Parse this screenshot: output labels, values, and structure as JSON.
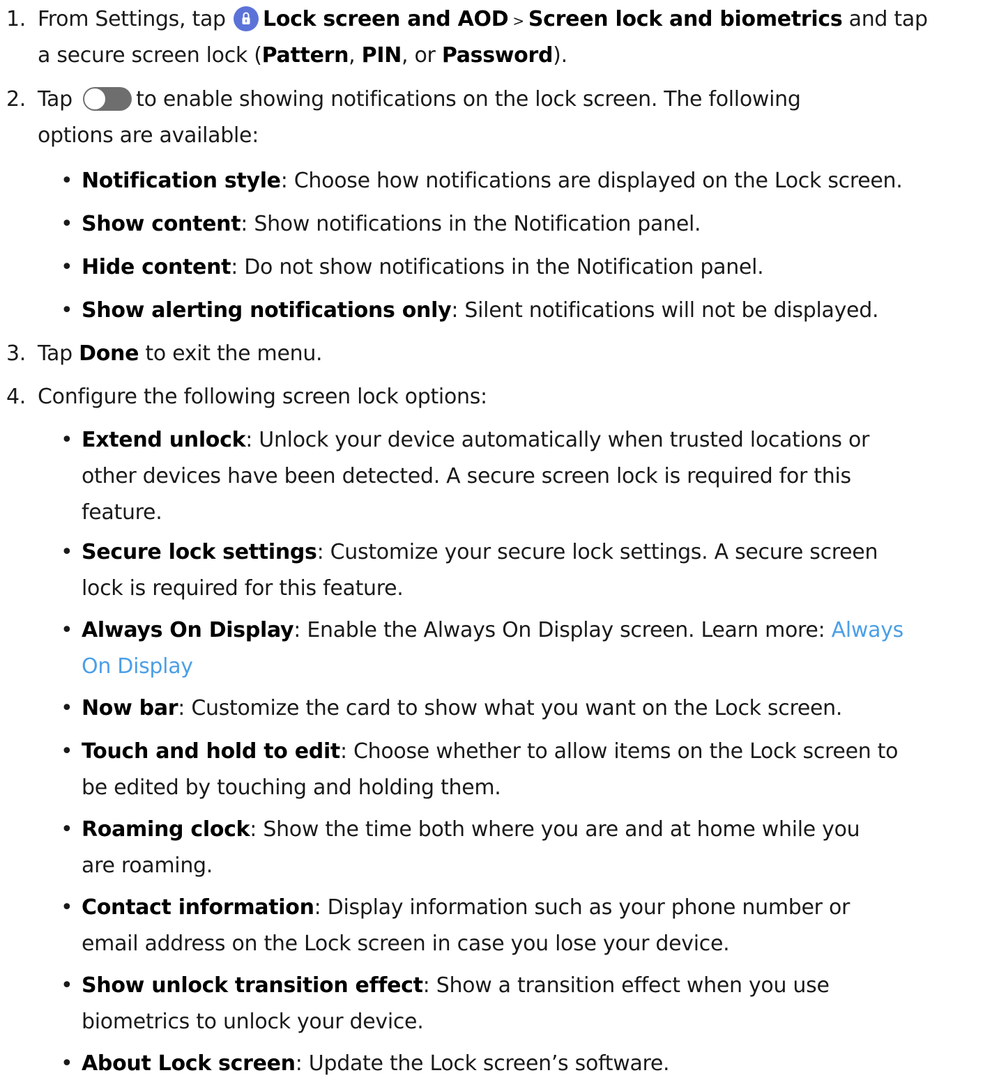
{
  "steps": [
    {
      "number": "1.",
      "lines": [
        {
          "pre": "From Settings, tap",
          "icon": "lock-icon",
          "b1": "Lock screen and AOD",
          "sep": " > ",
          "b2": "Screen lock and biometrics",
          "post": " and tap"
        },
        {
          "pre": "a secure screen lock (",
          "b1": "Pattern",
          "m1": ", ",
          "b2": "PIN",
          "m2": ", or ",
          "b3": "Password",
          "post": ")."
        }
      ]
    },
    {
      "number": "2.",
      "lines": [
        {
          "pre": "Tap",
          "icon": "toggle-switch-icon",
          "post": "to enable showing notifications on the lock screen. The following"
        },
        {
          "text": "options are available:"
        }
      ],
      "bullets": [
        {
          "term": "Notification style",
          "desc": ": Choose how notifications are displayed on the Lock screen."
        },
        {
          "term": "Show content",
          "desc": ": Show notifications in the Notification panel."
        },
        {
          "term": "Hide content",
          "desc": ": Do not show notifications in the Notification panel."
        },
        {
          "term": "Show alerting notifications only",
          "desc": ": Silent notifications will not be displayed."
        }
      ]
    },
    {
      "number": "3.",
      "lines": [
        {
          "pre": "Tap ",
          "b1": "Done",
          "post": " to exit the menu."
        }
      ]
    },
    {
      "number": "4.",
      "lines": [
        {
          "text": "Configure the following screen lock options:"
        }
      ],
      "bullets": [
        {
          "term": "Extend unlock",
          "desc_lines": [
            ": Unlock your device automatically when trusted locations or",
            "other devices have been detected. A secure screen lock is required for this",
            "feature."
          ]
        },
        {
          "term": "Secure lock settings",
          "desc_lines": [
            ": Customize your secure lock settings. A secure screen",
            "lock is required for this feature."
          ]
        },
        {
          "term": "Always On Display",
          "desc_lines": [
            ": Enable the Always On Display screen. Learn more: "
          ],
          "link_lines": [
            "Always",
            "On Display"
          ]
        },
        {
          "term": "Now bar",
          "desc_lines": [
            ": Customize the card to show what you want on the Lock screen."
          ]
        },
        {
          "term": "Touch and hold to edit",
          "desc_lines": [
            ": Choose whether to allow items on the Lock screen to",
            "be edited by touching and holding them."
          ]
        },
        {
          "term": "Roaming clock",
          "desc_lines": [
            ": Show the time both where you are and at home while you",
            "are roaming."
          ]
        },
        {
          "term": "Contact information",
          "desc_lines": [
            ": Display information such as your phone number or",
            "email address on the Lock screen in case you lose your device."
          ]
        },
        {
          "term": "Show unlock transition effect",
          "desc_lines": [
            ": Show a transition effect when you use",
            "biometrics to unlock your device."
          ]
        },
        {
          "term": "About Lock screen",
          "desc_lines": [
            ": Update the Lock screen’s software."
          ]
        }
      ]
    }
  ],
  "bullet_glyph": "•"
}
